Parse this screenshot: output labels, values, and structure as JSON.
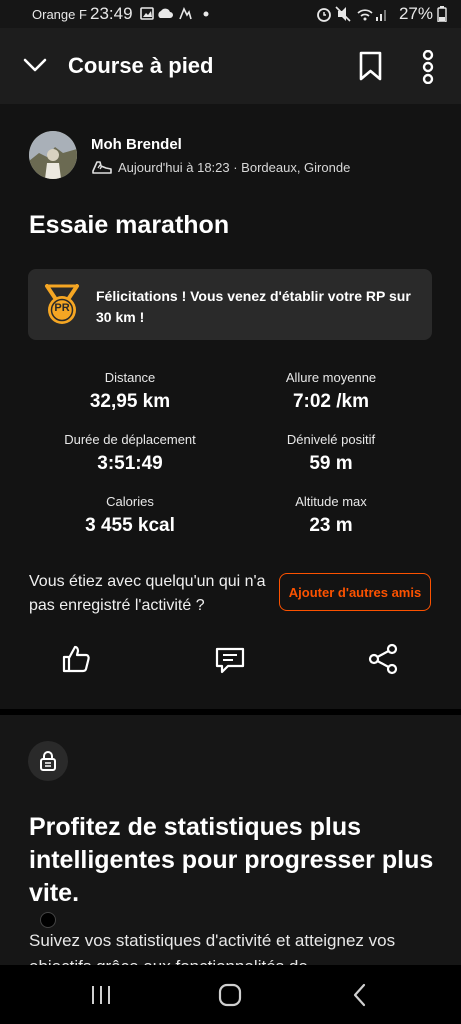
{
  "status_bar": {
    "carrier": "Orange F",
    "time": "23:49",
    "battery": "27%"
  },
  "header": {
    "title": "Course à pied"
  },
  "athlete": {
    "name": "Moh Brendel",
    "meta": "Aujourd'hui à 18:23 · Bordeaux, Gironde"
  },
  "activity": {
    "title": "Essaie marathon"
  },
  "pr_banner": {
    "badge": "PR",
    "text": "Félicitations ! Vous venez d'établir votre RP sur 30 km !"
  },
  "stats": [
    {
      "label": "Distance",
      "value": "32,95 km"
    },
    {
      "label": "Allure moyenne",
      "value": "7:02 /km"
    },
    {
      "label": "Durée de déplacement",
      "value": "3:51:49"
    },
    {
      "label": "Dénivelé positif",
      "value": "59 m"
    },
    {
      "label": "Calories",
      "value": "3 455 kcal"
    },
    {
      "label": "Altitude max",
      "value": "23 m"
    }
  ],
  "friends": {
    "question": "Vous étiez avec quelqu'un qui n'a pas enregistré l'activité ?",
    "button": "Ajouter d'autres amis"
  },
  "promo": {
    "title": "Profitez de statistiques plus intelligentes pour progresser plus vite.",
    "text": "Suivez vos statistiques d'activité et atteignez vos objectifs grâce aux fonctionnalités de"
  },
  "colors": {
    "accent": "#fc5200",
    "pr_badge": "#f5a623"
  }
}
